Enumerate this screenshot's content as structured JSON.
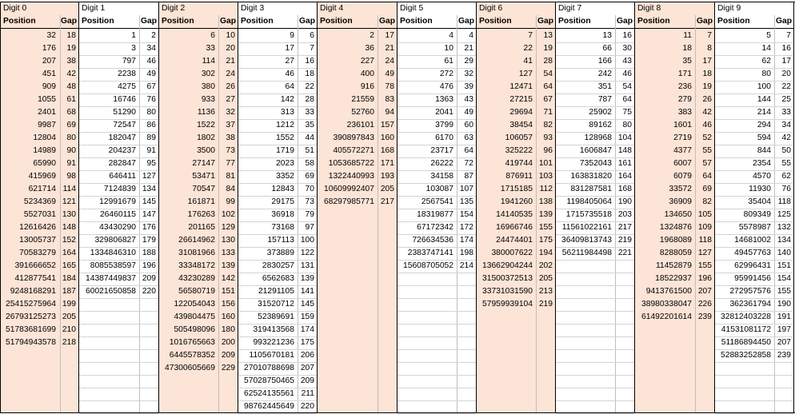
{
  "headers": {
    "position": "Position",
    "gap": "Gap"
  },
  "digits": [
    {
      "title": "Digit 0",
      "shaded": true,
      "rows": [
        [
          "32",
          "18"
        ],
        [
          "176",
          "19"
        ],
        [
          "207",
          "38"
        ],
        [
          "451",
          "42"
        ],
        [
          "909",
          "48"
        ],
        [
          "1055",
          "61"
        ],
        [
          "2401",
          "68"
        ],
        [
          "9987",
          "69"
        ],
        [
          "12804",
          "80"
        ],
        [
          "14989",
          "90"
        ],
        [
          "65990",
          "91"
        ],
        [
          "415969",
          "98"
        ],
        [
          "621714",
          "114"
        ],
        [
          "5234369",
          "121"
        ],
        [
          "5527031",
          "130"
        ],
        [
          "12616426",
          "148"
        ],
        [
          "13005737",
          "152"
        ],
        [
          "70583279",
          "164"
        ],
        [
          "391666652",
          "165"
        ],
        [
          "412877541",
          "184"
        ],
        [
          "9248168291",
          "187"
        ],
        [
          "25415275964",
          "199"
        ],
        [
          "26793125273",
          "205"
        ],
        [
          "51783681699",
          "210"
        ],
        [
          "51794943578",
          "218"
        ]
      ]
    },
    {
      "title": "Digit 1",
      "shaded": false,
      "rows": [
        [
          "1",
          "2"
        ],
        [
          "3",
          "34"
        ],
        [
          "797",
          "46"
        ],
        [
          "2238",
          "49"
        ],
        [
          "4275",
          "67"
        ],
        [
          "16746",
          "76"
        ],
        [
          "51290",
          "80"
        ],
        [
          "72547",
          "86"
        ],
        [
          "182047",
          "89"
        ],
        [
          "204237",
          "91"
        ],
        [
          "282847",
          "95"
        ],
        [
          "646411",
          "127"
        ],
        [
          "7124839",
          "134"
        ],
        [
          "12991679",
          "145"
        ],
        [
          "26460115",
          "147"
        ],
        [
          "43430290",
          "176"
        ],
        [
          "329806827",
          "179"
        ],
        [
          "1334846310",
          "188"
        ],
        [
          "8085538597",
          "196"
        ],
        [
          "14387449837",
          "209"
        ],
        [
          "60021650858",
          "220"
        ]
      ]
    },
    {
      "title": "Digit 2",
      "shaded": true,
      "rows": [
        [
          "6",
          "10"
        ],
        [
          "33",
          "20"
        ],
        [
          "114",
          "21"
        ],
        [
          "302",
          "24"
        ],
        [
          "380",
          "26"
        ],
        [
          "933",
          "27"
        ],
        [
          "1136",
          "32"
        ],
        [
          "1522",
          "37"
        ],
        [
          "1802",
          "38"
        ],
        [
          "3500",
          "73"
        ],
        [
          "27147",
          "77"
        ],
        [
          "53471",
          "81"
        ],
        [
          "70547",
          "84"
        ],
        [
          "161871",
          "99"
        ],
        [
          "176263",
          "102"
        ],
        [
          "201165",
          "129"
        ],
        [
          "26614962",
          "130"
        ],
        [
          "31081966",
          "133"
        ],
        [
          "33348172",
          "139"
        ],
        [
          "43230289",
          "142"
        ],
        [
          "56580719",
          "151"
        ],
        [
          "122054043",
          "156"
        ],
        [
          "439804475",
          "160"
        ],
        [
          "505498096",
          "180"
        ],
        [
          "1016765663",
          "200"
        ],
        [
          "6445578352",
          "209"
        ],
        [
          "47300605669",
          "229"
        ]
      ]
    },
    {
      "title": "Digit 3",
      "shaded": false,
      "rows": [
        [
          "9",
          "6"
        ],
        [
          "17",
          "7"
        ],
        [
          "27",
          "16"
        ],
        [
          "46",
          "18"
        ],
        [
          "64",
          "22"
        ],
        [
          "142",
          "28"
        ],
        [
          "313",
          "33"
        ],
        [
          "1212",
          "35"
        ],
        [
          "1552",
          "44"
        ],
        [
          "1719",
          "51"
        ],
        [
          "2023",
          "58"
        ],
        [
          "3352",
          "69"
        ],
        [
          "12843",
          "70"
        ],
        [
          "29175",
          "73"
        ],
        [
          "36918",
          "79"
        ],
        [
          "73168",
          "97"
        ],
        [
          "157113",
          "100"
        ],
        [
          "373889",
          "122"
        ],
        [
          "2830257",
          "131"
        ],
        [
          "6562683",
          "139"
        ],
        [
          "21291105",
          "141"
        ],
        [
          "31520712",
          "145"
        ],
        [
          "52389691",
          "159"
        ],
        [
          "319413568",
          "174"
        ],
        [
          "993221236",
          "175"
        ],
        [
          "1105670181",
          "206"
        ],
        [
          "27010788698",
          "207"
        ],
        [
          "57028750465",
          "209"
        ],
        [
          "62524135561",
          "211"
        ],
        [
          "98762445649",
          "220"
        ]
      ]
    },
    {
      "title": "Digit 4",
      "shaded": true,
      "rows": [
        [
          "2",
          "17"
        ],
        [
          "36",
          "21"
        ],
        [
          "227",
          "24"
        ],
        [
          "400",
          "49"
        ],
        [
          "916",
          "78"
        ],
        [
          "21559",
          "83"
        ],
        [
          "52760",
          "94"
        ],
        [
          "236101",
          "157"
        ],
        [
          "390897843",
          "160"
        ],
        [
          "405572271",
          "168"
        ],
        [
          "1053685722",
          "171"
        ],
        [
          "1322440993",
          "193"
        ],
        [
          "10609992407",
          "205"
        ],
        [
          "68297985771",
          "217"
        ]
      ]
    },
    {
      "title": "Digit 5",
      "shaded": false,
      "rows": [
        [
          "4",
          "4"
        ],
        [
          "10",
          "21"
        ],
        [
          "61",
          "29"
        ],
        [
          "272",
          "32"
        ],
        [
          "476",
          "39"
        ],
        [
          "1363",
          "43"
        ],
        [
          "2041",
          "49"
        ],
        [
          "3799",
          "60"
        ],
        [
          "6170",
          "63"
        ],
        [
          "23717",
          "64"
        ],
        [
          "26222",
          "72"
        ],
        [
          "34158",
          "87"
        ],
        [
          "103087",
          "107"
        ],
        [
          "2567541",
          "135"
        ],
        [
          "18319877",
          "154"
        ],
        [
          "67172342",
          "172"
        ],
        [
          "726634536",
          "174"
        ],
        [
          "2383747141",
          "198"
        ],
        [
          "15608705052",
          "214"
        ]
      ]
    },
    {
      "title": "Digit 6",
      "shaded": true,
      "rows": [
        [
          "7",
          "13"
        ],
        [
          "22",
          "19"
        ],
        [
          "41",
          "28"
        ],
        [
          "127",
          "54"
        ],
        [
          "12471",
          "64"
        ],
        [
          "27215",
          "67"
        ],
        [
          "29694",
          "71"
        ],
        [
          "38454",
          "82"
        ],
        [
          "106057",
          "93"
        ],
        [
          "325222",
          "96"
        ],
        [
          "419744",
          "101"
        ],
        [
          "876911",
          "103"
        ],
        [
          "1715185",
          "112"
        ],
        [
          "1941260",
          "138"
        ],
        [
          "14140535",
          "139"
        ],
        [
          "16966746",
          "155"
        ],
        [
          "24474401",
          "175"
        ],
        [
          "380007622",
          "194"
        ],
        [
          "13662904244",
          "202"
        ],
        [
          "31500372513",
          "205"
        ],
        [
          "33731031590",
          "213"
        ],
        [
          "57959939104",
          "219"
        ]
      ]
    },
    {
      "title": "Digit 7",
      "shaded": false,
      "rows": [
        [
          "13",
          "16"
        ],
        [
          "66",
          "30"
        ],
        [
          "166",
          "43"
        ],
        [
          "242",
          "46"
        ],
        [
          "351",
          "54"
        ],
        [
          "787",
          "64"
        ],
        [
          "25902",
          "75"
        ],
        [
          "89162",
          "80"
        ],
        [
          "128968",
          "104"
        ],
        [
          "1606847",
          "148"
        ],
        [
          "7352043",
          "161"
        ],
        [
          "163831820",
          "164"
        ],
        [
          "831287581",
          "168"
        ],
        [
          "1198405064",
          "190"
        ],
        [
          "1715735518",
          "203"
        ],
        [
          "11561022161",
          "217"
        ],
        [
          "36409813743",
          "219"
        ],
        [
          "56211984498",
          "221"
        ]
      ]
    },
    {
      "title": "Digit 8",
      "shaded": true,
      "rows": [
        [
          "11",
          "7"
        ],
        [
          "18",
          "8"
        ],
        [
          "35",
          "17"
        ],
        [
          "171",
          "18"
        ],
        [
          "236",
          "19"
        ],
        [
          "279",
          "26"
        ],
        [
          "383",
          "42"
        ],
        [
          "1601",
          "46"
        ],
        [
          "2719",
          "52"
        ],
        [
          "4377",
          "55"
        ],
        [
          "6007",
          "57"
        ],
        [
          "6079",
          "64"
        ],
        [
          "33572",
          "69"
        ],
        [
          "36909",
          "82"
        ],
        [
          "134650",
          "105"
        ],
        [
          "1324876",
          "109"
        ],
        [
          "1968089",
          "118"
        ],
        [
          "8288059",
          "127"
        ],
        [
          "11452879",
          "155"
        ],
        [
          "18522937",
          "196"
        ],
        [
          "9413761500",
          "207"
        ],
        [
          "38980338047",
          "226"
        ],
        [
          "61492201614",
          "239"
        ]
      ]
    },
    {
      "title": "Digit 9",
      "shaded": false,
      "rows": [
        [
          "5",
          "7"
        ],
        [
          "14",
          "16"
        ],
        [
          "62",
          "17"
        ],
        [
          "80",
          "20"
        ],
        [
          "100",
          "22"
        ],
        [
          "144",
          "25"
        ],
        [
          "214",
          "33"
        ],
        [
          "294",
          "34"
        ],
        [
          "594",
          "42"
        ],
        [
          "844",
          "50"
        ],
        [
          "2354",
          "55"
        ],
        [
          "4570",
          "62"
        ],
        [
          "11930",
          "76"
        ],
        [
          "35404",
          "118"
        ],
        [
          "809349",
          "125"
        ],
        [
          "5578987",
          "132"
        ],
        [
          "14681002",
          "134"
        ],
        [
          "49457763",
          "140"
        ],
        [
          "62996431",
          "151"
        ],
        [
          "95991456",
          "154"
        ],
        [
          "272957576",
          "155"
        ],
        [
          "362361794",
          "190"
        ],
        [
          "32812403228",
          "191"
        ],
        [
          "41531081172",
          "197"
        ],
        [
          "51186894450",
          "207"
        ],
        [
          "52883252858",
          "239"
        ]
      ]
    }
  ]
}
